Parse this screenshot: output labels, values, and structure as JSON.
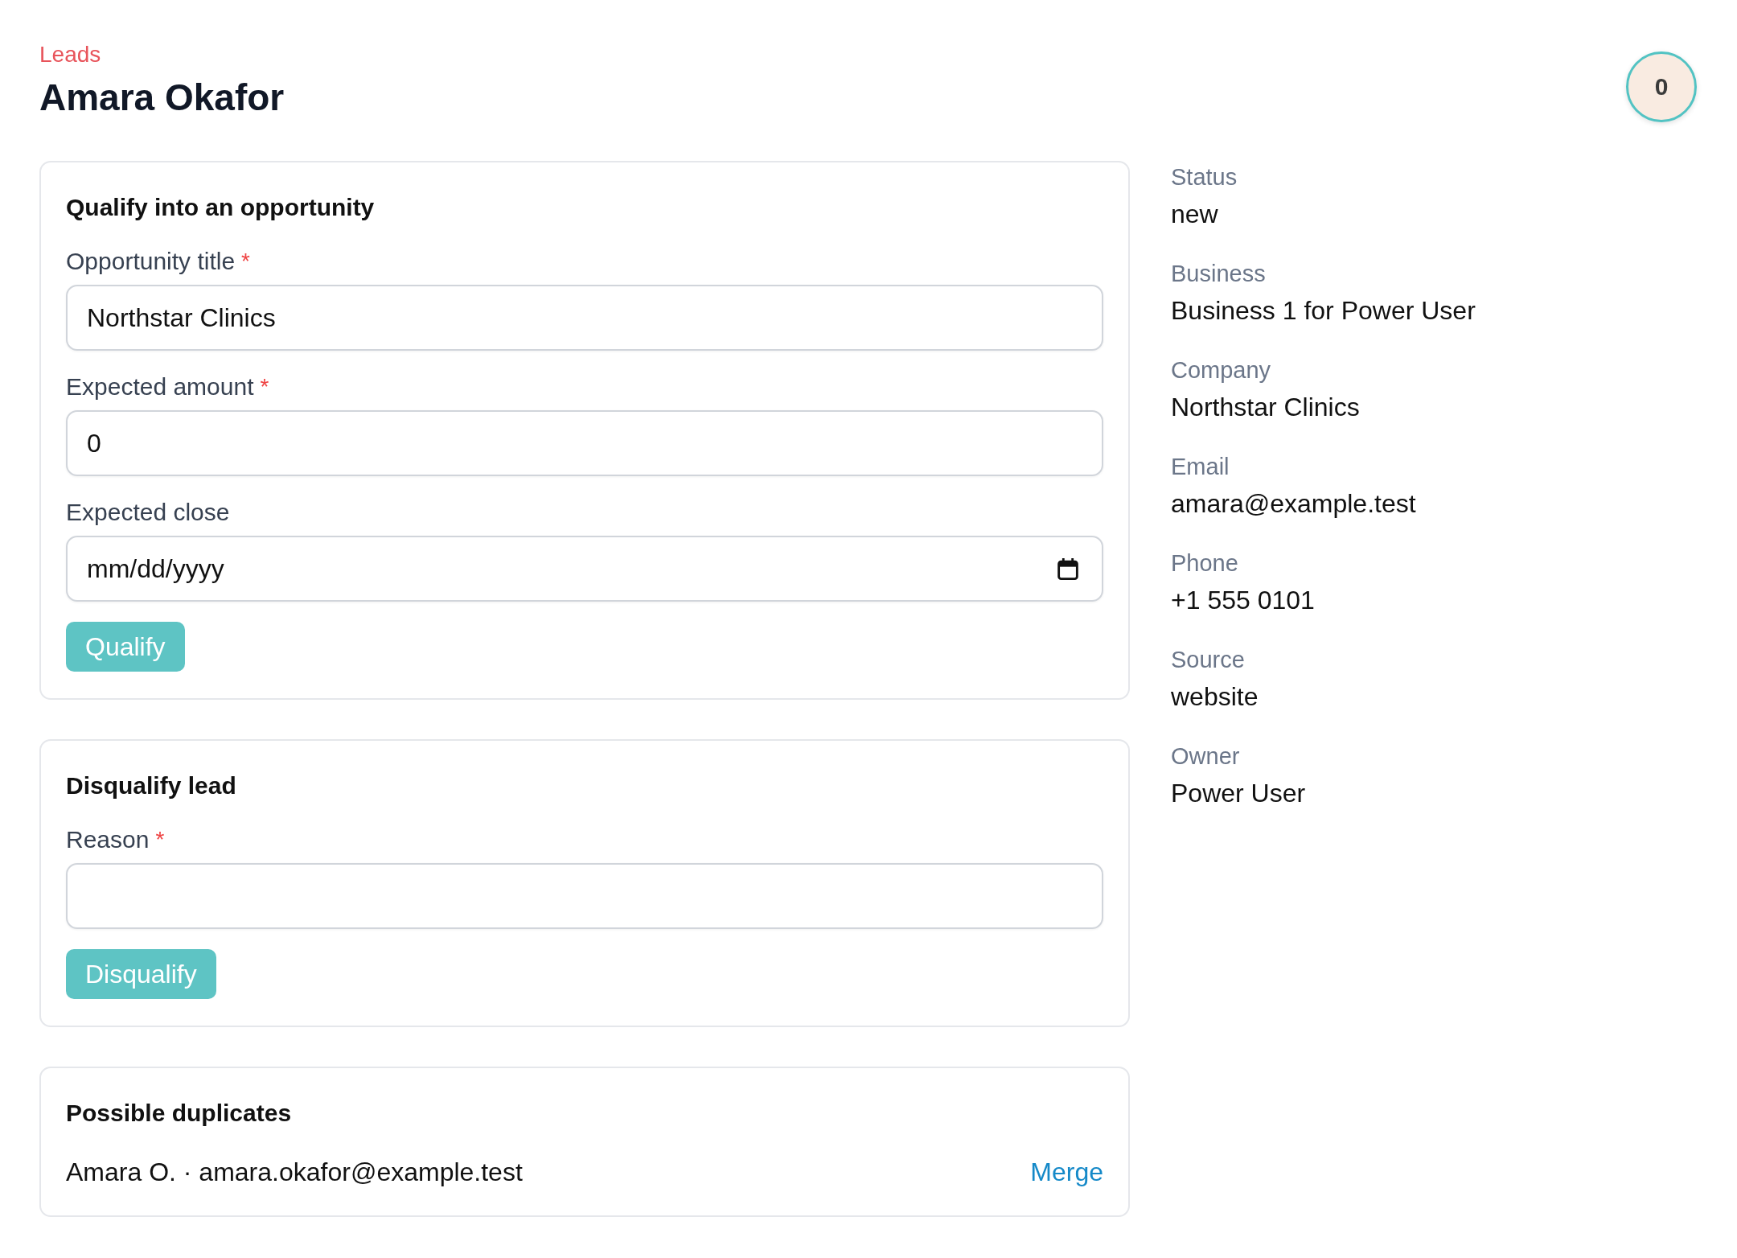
{
  "breadcrumb": {
    "label": "Leads"
  },
  "title": "Amara Okafor",
  "avatar": {
    "initials": "0"
  },
  "qualify_form": {
    "heading": "Qualify into an opportunity",
    "fields": [
      {
        "kind": "text",
        "label": "Opportunity title",
        "required_mark": "*",
        "value": "Northstar Clinics"
      },
      {
        "kind": "text",
        "label": "Expected amount",
        "required_mark": "*",
        "value": "0"
      },
      {
        "kind": "date",
        "label": "Expected close",
        "placeholder": "mm/dd/yyyy"
      }
    ],
    "button": "Qualify"
  },
  "disqualify_form": {
    "heading": "Disqualify lead",
    "fields": [
      {
        "kind": "text",
        "label": "Reason",
        "required_mark": "*"
      }
    ],
    "button": "Disqualify"
  },
  "duplicates": {
    "heading": "Possible duplicates",
    "items": [
      {
        "text": "Amara O. · amara.okafor@example.test",
        "action": "Merge"
      }
    ]
  },
  "details": [
    {
      "label": "Status",
      "value": "new"
    },
    {
      "label": "Business",
      "value": "Business 1 for Power User"
    },
    {
      "label": "Company",
      "value": "Northstar Clinics"
    },
    {
      "label": "Email",
      "value": "amara@example.test"
    },
    {
      "label": "Phone",
      "value": "+1 555 0101"
    },
    {
      "label": "Source",
      "value": "website"
    },
    {
      "label": "Owner",
      "value": "Power User"
    }
  ]
}
